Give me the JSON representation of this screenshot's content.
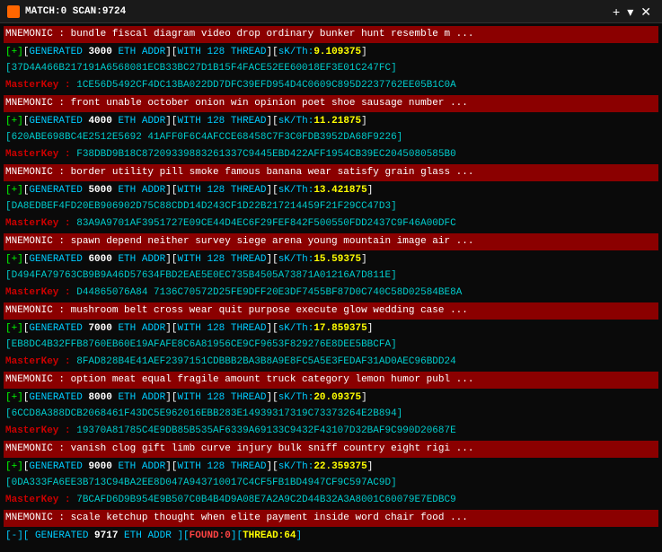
{
  "titlebar": {
    "match": "MATCH:0",
    "scan": "SCAN:9724",
    "title": "MATCH:0 SCAN:9724",
    "plus": "+",
    "dropdown": "▾",
    "close": "✕"
  },
  "blocks": [
    {
      "mnemonic": "MNEMONIC : bundle fiscal diagram video drop ordinary bunker hunt resemble m ...",
      "generated": "[+][GENERATED 3000 ETH ADDR][WITH 128 THREAD][sK/Th:9.109375]",
      "hash": "[37D4A466B217191A6568081ECB33BC27D1B15F4FACE52EE60018EF3E01C247FC]",
      "masterkey_label": "MasterKey :",
      "masterkey_value": "1CE56D5492CF4DC13BA022DD7DFC39EFD954D4C0609C895D2237762EE05B1C0A"
    },
    {
      "mnemonic": "MNEMONIC : front unable october onion win opinion poet shoe sausage number ...",
      "generated": "[+][GENERATED 4000 ETH ADDR][WITH 128 THREAD][sK/Th:11.21875]",
      "hash": "[620ABE698BC4E2512E5692 41AFF0F6C4AFCCE68458C7F3C0FDB3952DA68F9226]",
      "masterkey_label": "MasterKey :",
      "masterkey_value": "F38DBD9B18C87209339883261337C9445EBD422AFF1954CB39EC2045080585B0"
    },
    {
      "mnemonic": "MNEMONIC : border utility pill smoke famous banana wear satisfy grain glass ...",
      "generated": "[+][GENERATED 5000 ETH ADDR][WITH 128 THREAD][sK/Th:13.421875]",
      "hash": "[DA8EDBEF4FD20EB906902D75C88CDD14D243CF1D22B217214459F21F29CC47D3]",
      "masterkey_label": "MasterKey :",
      "masterkey_value": "83A9A9701AF3951727E09CE44D4EC6F29FEF842F500550FDD2437C9F46A00DFC"
    },
    {
      "mnemonic": "MNEMONIC : spawn depend neither survey siege arena young mountain image air ...",
      "generated": "[+][GENERATED 6000 ETH ADDR][WITH 128 THREAD][sK/Th:15.59375]",
      "hash": "[D494FA79763CB9B9A46D57634FBD2EAE5E0EC735B4505A73871A01216A7D811E]",
      "masterkey_label": "MasterKey :",
      "masterkey_value": "D44865076A84 7136C70572D25FE9DFF20E3DF7455BF87D0C740C58D02584BE8A"
    },
    {
      "mnemonic": "MNEMONIC : mushroom belt cross wear quit purpose execute glow wedding case ...",
      "generated": "[+][GENERATED 7000 ETH ADDR][WITH 128 THREAD][sK/Th:17.859375]",
      "hash": "[EB8DC4B32FFB8760EB60E19AFAFE8C6A81956CE9CF9653F829276E8DEE5BBCFA]",
      "masterkey_label": "MasterKey :",
      "masterkey_value": "8FAD828B4E41AEF2397151CDBBB2BA3B8A9E8FC5A5E3FEDAF31AD0AEC96BDD24"
    },
    {
      "mnemonic": "MNEMONIC : option meat equal fragile amount truck category lemon humor publ ...",
      "generated": "[+][GENERATED 8000 ETH ADDR][WITH 128 THREAD][sK/Th:20.09375]",
      "hash": "[6CCD8A388DCB2068461F43DC5E962016EBB283E14939317319C73373264E2B894]",
      "masterkey_label": "MasterKey :",
      "masterkey_value": "19370A81785C4E9DB85B535AF6339A69133C9432F43107D32BAF9C990D20687E"
    },
    {
      "mnemonic": "MNEMONIC : vanish clog gift limb curve injury bulk sniff country eight rigi ...",
      "generated": "[+][GENERATED 9000 ETH ADDR][WITH 128 THREAD][sK/Th:22.359375]",
      "hash": "[0DA333FA6EE3B713C94BA2EE8D047A943710017C4CF5FB1BD4947CF9C597AC9D]",
      "masterkey_label": "MasterKey :",
      "masterkey_value": "7BCAFD6D9B954E9B507C0B4B4D9A08E7A2A9C2D44B32A3A8001C60079E7EDBC9"
    },
    {
      "mnemonic": "MNEMONIC : scale ketchup thought when elite payment inside word chair food ...",
      "generated": "[-][ GENERATED 9717 ETH ADDR ][FOUND:0][THREAD:64]",
      "hash": "",
      "masterkey_label": "",
      "masterkey_value": ""
    }
  ],
  "statusbar": {
    "prefix": "[-][",
    "generated_label": " GENERATED ",
    "generated_num": "9717",
    "eth_addr": " ETH ADDR ",
    "found_label": "][FOUND:",
    "found_num": "0",
    "thread_label": "][THREAD:",
    "thread_num": "64",
    "suffix": "]"
  }
}
